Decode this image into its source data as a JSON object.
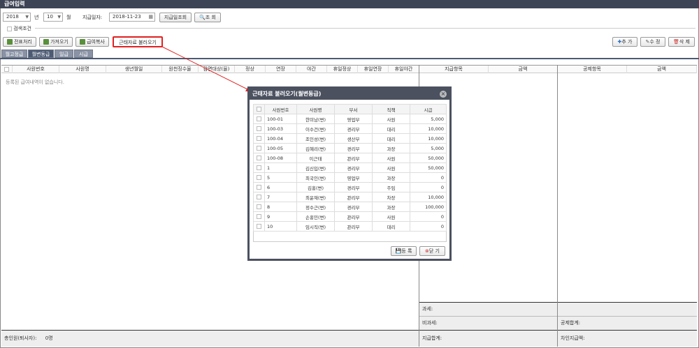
{
  "window": {
    "title": "급여입력"
  },
  "filters": {
    "year": "2018",
    "year_suffix": "년",
    "month": "10",
    "month_suffix": "월",
    "pay_date_label": "지급일자:",
    "pay_date": "2018-11-23",
    "pay_date_query_btn": "지급일조회",
    "query_btn": "조 회",
    "search_condition": "검색조건"
  },
  "toolbar": {
    "voucher": "전표처리",
    "import": "가져오기",
    "copy_pay": "급여복사",
    "load_attendance": "근태자료 불러오기",
    "add": "추 가",
    "edit": "수 정",
    "delete": "삭 제"
  },
  "tabs": [
    "월고정급",
    "월변동급",
    "일급",
    "시급"
  ],
  "grid": {
    "columns": [
      "사원번호",
      "사원명",
      "생년월일",
      "원천징수율",
      "감면대상(율)",
      "정상",
      "연장",
      "야간",
      "휴일정상",
      "휴일연장",
      "휴일야간"
    ],
    "empty_message": "등록된 급여내역이 없습니다.",
    "pay_columns": [
      "지급항목",
      "금액"
    ],
    "deduct_columns": [
      "공제항목",
      "금액"
    ]
  },
  "summary": {
    "taxable": "과세:",
    "nontaxable": "비과세:",
    "pay_total": "지급합계:",
    "deduct_total": "공제합계:",
    "net_pay": "차인지급액:",
    "headcount_label": "총인원(퇴사자):",
    "headcount_value": "0명"
  },
  "modal": {
    "title": "근태자료 불러오기(월변동급)",
    "columns": [
      "사원번호",
      "사원명",
      "부서",
      "직책",
      "시급"
    ],
    "rows": [
      [
        "100-01",
        "한미남(변)",
        "영업부",
        "사원",
        "5,000"
      ],
      [
        "100-03",
        "이수건(변)",
        "경리부",
        "대리",
        "10,000"
      ],
      [
        "100-04",
        "조인성(변)",
        "생산부",
        "대리",
        "10,000"
      ],
      [
        "100-05",
        "김혜리(변)",
        "경리부",
        "과장",
        "5,000"
      ],
      [
        "100-08",
        "이근태",
        "관리부",
        "사원",
        "50,000"
      ],
      [
        "1",
        "김신입(변)",
        "경리부",
        "사원",
        "50,000"
      ],
      [
        "5",
        "최국인(변)",
        "영업부",
        "과장",
        "0"
      ],
      [
        "6",
        "김홍(변)",
        "경리부",
        "주임",
        "0"
      ],
      [
        "7",
        "최윤재(변)",
        "관리부",
        "차장",
        "10,000"
      ],
      [
        "8",
        "정수근(변)",
        "경리부",
        "과장",
        "100,000"
      ],
      [
        "9",
        "손홍민(변)",
        "관리부",
        "사원",
        "0"
      ],
      [
        "10",
        "임시직(변)",
        "관리부",
        "대리",
        "0"
      ]
    ],
    "register_btn": "등 록",
    "close_btn": "닫 기"
  },
  "colors": {
    "titlebar": "#3d4455",
    "highlight": "#e02020",
    "modal_header": "#4c5160"
  }
}
